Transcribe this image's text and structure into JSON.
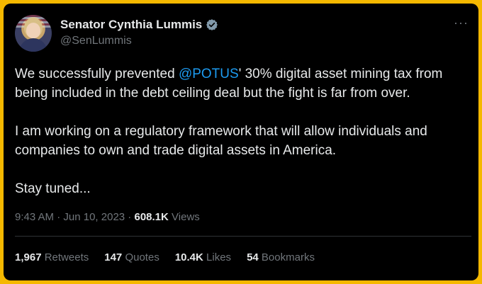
{
  "author": {
    "name": "Senator Cynthia Lummis",
    "handle": "@SenLummis",
    "verified_color": "#829aab"
  },
  "tweet": {
    "p1_before": "We successfully prevented ",
    "mention": "@POTUS",
    "p1_after": "' 30% digital asset mining tax from being included in the debt ceiling deal but the fight is far from over.",
    "p2": "I am working on a regulatory framework that will allow individuals and companies to own and trade digital assets in America.",
    "p3": "Stay tuned..."
  },
  "meta": {
    "time": "9:43 AM",
    "sep": " · ",
    "date": "Jun 10, 2023",
    "views_count": "608.1K",
    "views_label": "Views"
  },
  "stats": {
    "retweets": {
      "count": "1,967",
      "label": "Retweets"
    },
    "quotes": {
      "count": "147",
      "label": "Quotes"
    },
    "likes": {
      "count": "10.4K",
      "label": "Likes"
    },
    "bookmarks": {
      "count": "54",
      "label": "Bookmarks"
    }
  },
  "icons": {
    "more": "more-icon",
    "verified": "verified-icon"
  },
  "colors": {
    "frame_border": "#f5b800",
    "background": "#000000",
    "text": "#e7e9ea",
    "secondary": "#71767b",
    "link": "#1d9bf0"
  }
}
